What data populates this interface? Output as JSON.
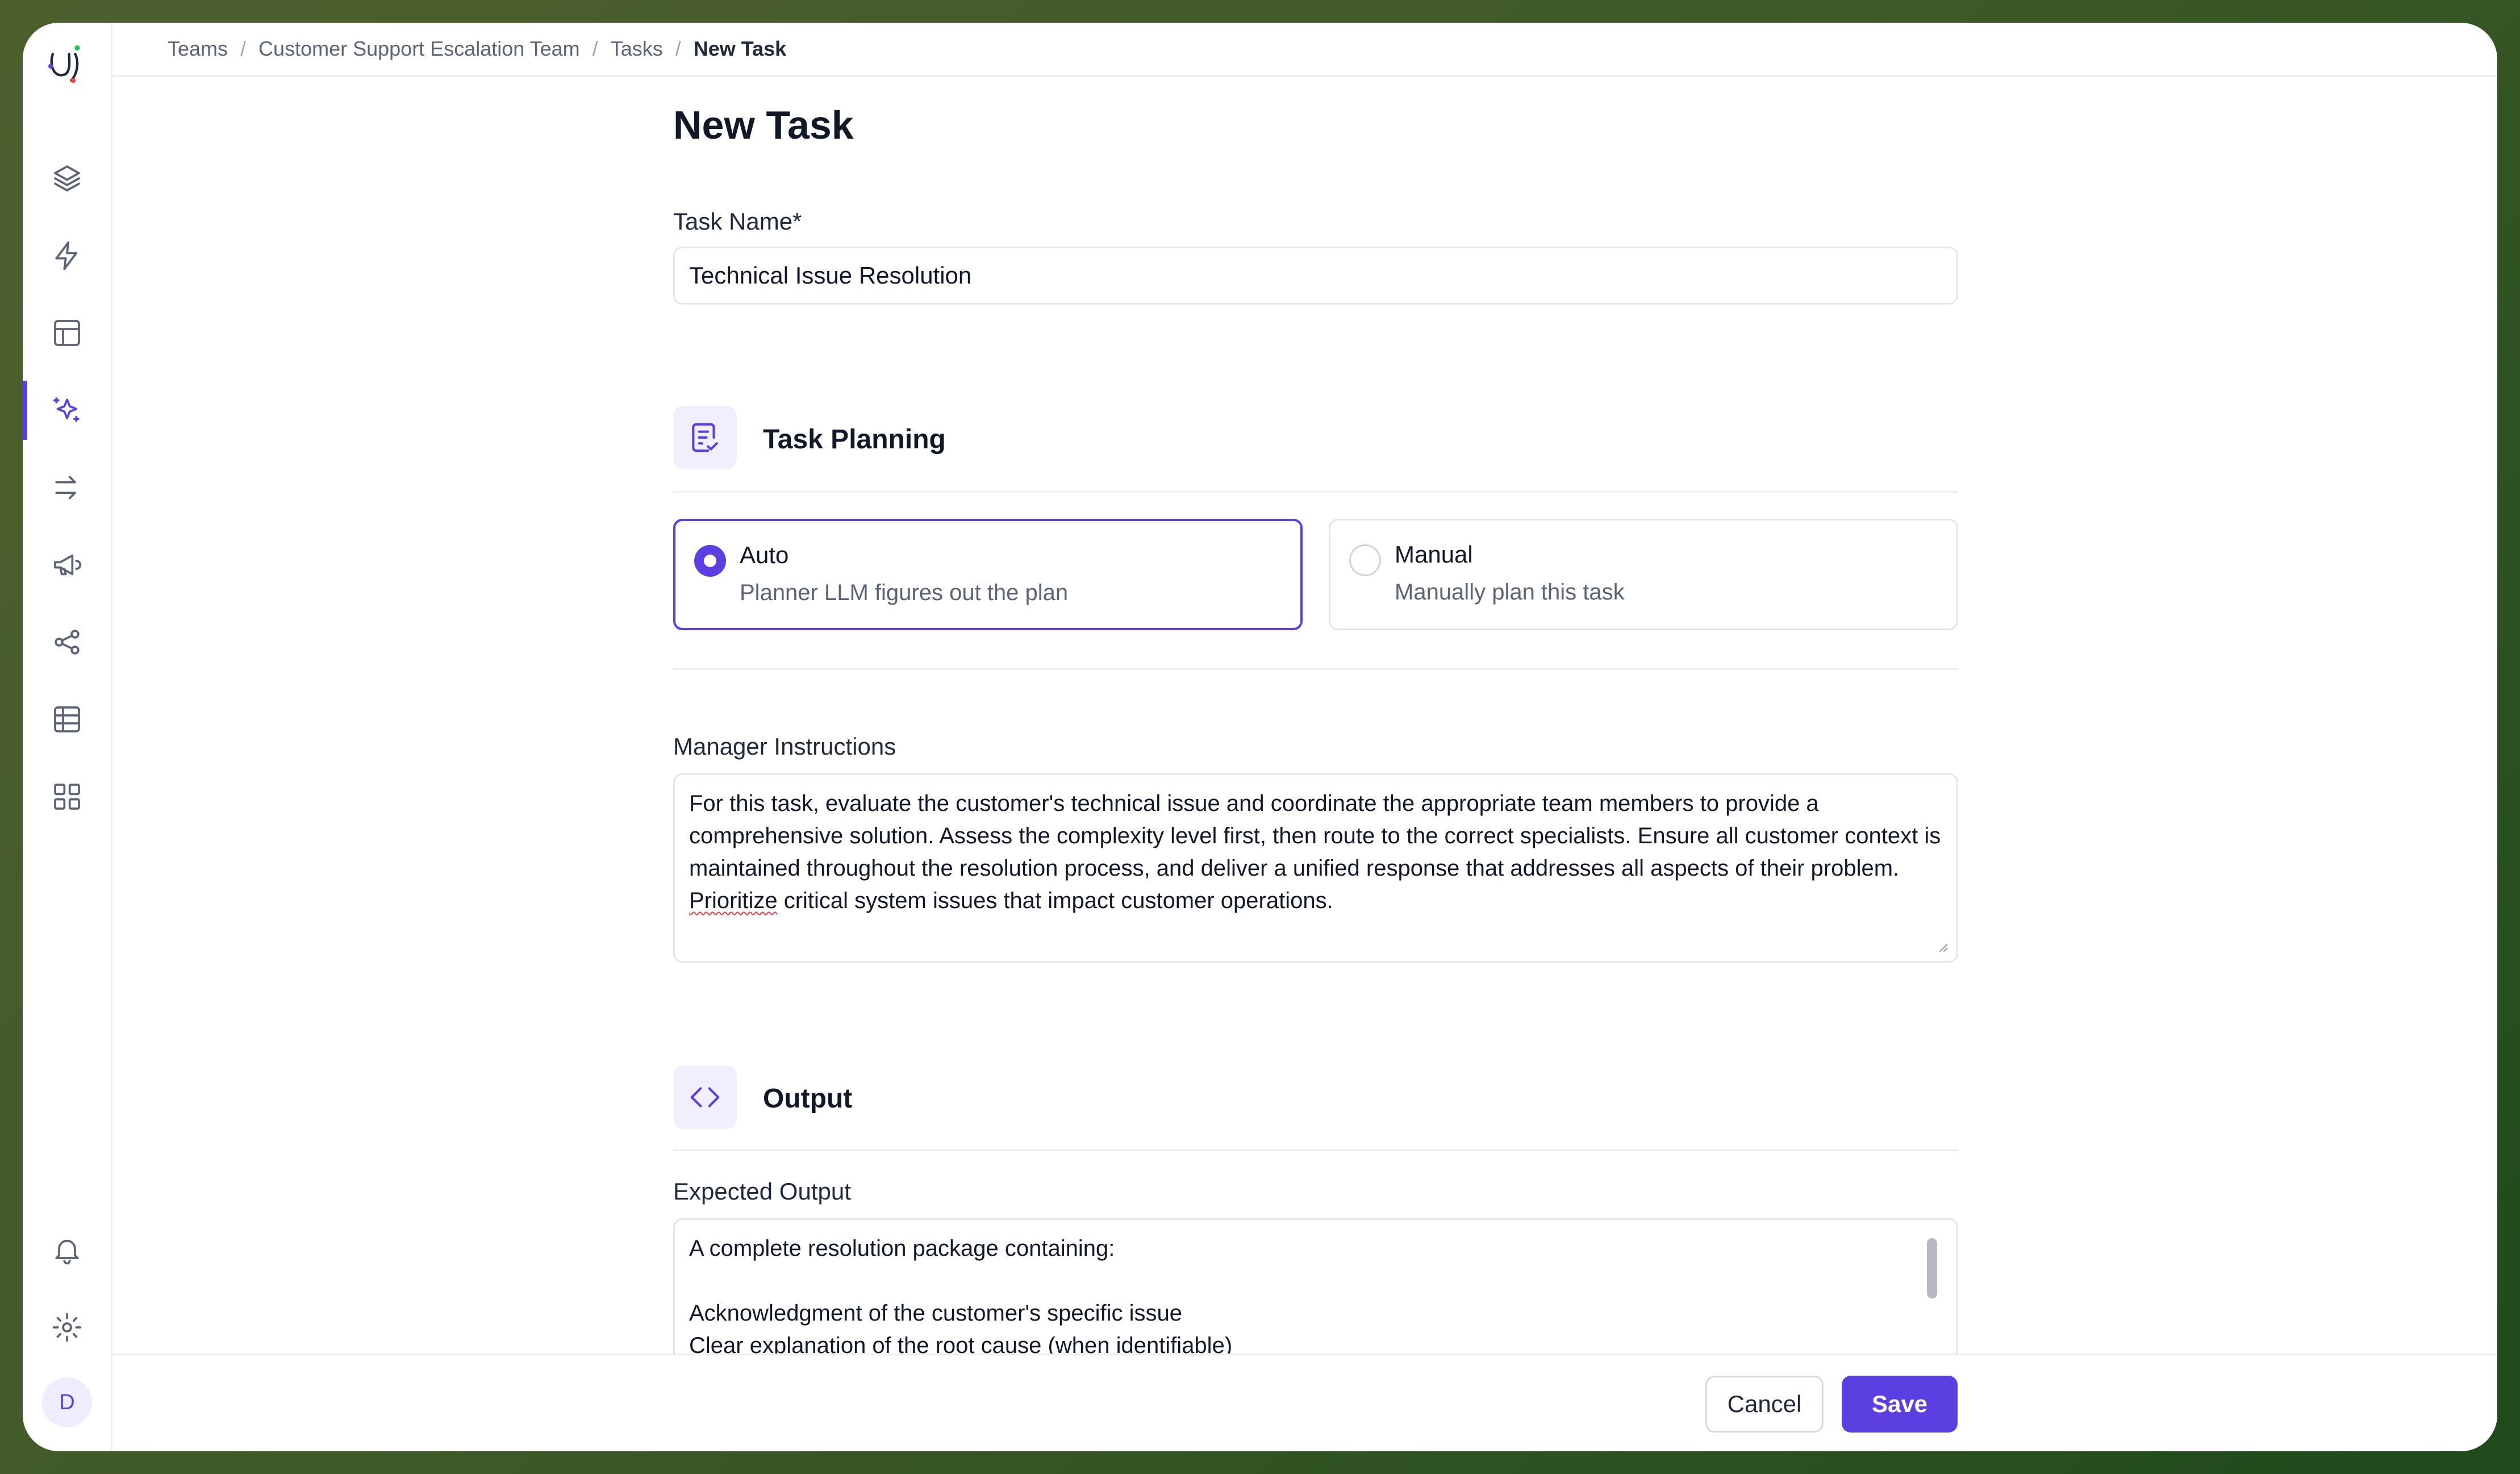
{
  "breadcrumb": {
    "items": [
      "Teams",
      "Customer Support Escalation Team",
      "Tasks"
    ],
    "current": "New Task",
    "separator": "/"
  },
  "sidebar": {
    "nav": [
      {
        "icon": "layers-icon"
      },
      {
        "icon": "lightning-icon"
      },
      {
        "icon": "layout-icon"
      },
      {
        "icon": "sparkles-icon",
        "active": true
      },
      {
        "icon": "route-arrows-icon"
      },
      {
        "icon": "megaphone-icon"
      },
      {
        "icon": "share-icon"
      },
      {
        "icon": "table-icon"
      },
      {
        "icon": "grid-icon"
      }
    ],
    "bottom": [
      {
        "icon": "bell-icon"
      },
      {
        "icon": "gear-icon"
      }
    ],
    "avatar_initial": "D"
  },
  "page": {
    "title": "New Task",
    "task_name_label": "Task Name*",
    "task_name_value": "Technical Issue Resolution"
  },
  "planning": {
    "section_title": "Task Planning",
    "section_icon": "checklist-icon",
    "options": [
      {
        "title": "Auto",
        "description": "Planner LLM figures out the plan",
        "selected": true
      },
      {
        "title": "Manual",
        "description": "Manually plan this task",
        "selected": false
      }
    ]
  },
  "manager_instructions": {
    "label": "Manager Instructions",
    "text_before": "For this task, evaluate the customer's technical issue and coordinate the appropriate team members to provide a comprehensive solution. Assess the complexity level first, then route to the correct specialists. Ensure all customer context is maintained throughout the resolution process, and deliver a unified response that addresses all aspects of their problem. ",
    "flagged_word": "Prioritize",
    "text_after": " critical system issues that impact customer operations."
  },
  "output": {
    "section_title": "Output",
    "section_icon": "code-icon",
    "expected_label": "Expected Output",
    "expected_text": "A complete resolution package containing:\n\nAcknowledgment of the customer's specific issue\nClear explanation of the root cause (when identifiable)\nStep-by-step troubleshooting instructions with visual aids"
  },
  "footer": {
    "cancel_label": "Cancel",
    "save_label": "Save"
  },
  "colors": {
    "accent": "#5b3fe0",
    "background_frame": "#3f5a27"
  }
}
